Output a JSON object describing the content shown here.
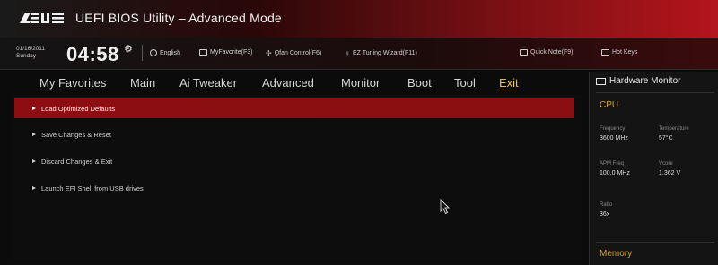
{
  "window": {
    "brand": "ASUS",
    "title": "UEFI BIOS Utility – Advanced Mode",
    "colors": {
      "accent_red": "#8c0e12",
      "active_tab": "#e8c33a",
      "section_gold": "#d8a21e"
    }
  },
  "infobar": {
    "date_line1": "01/16/2011",
    "date_line2": "Sunday",
    "time": "04:58",
    "items": [
      {
        "icon": "globe-icon",
        "label": "English"
      },
      {
        "icon": "favorites-icon",
        "label": "MyFavorite(F3)"
      },
      {
        "icon": "fan-icon",
        "label": "Qfan Control(F6)"
      },
      {
        "icon": "bulb-icon",
        "label": "EZ Tuning Wizard(F11)"
      },
      {
        "icon": "note-icon",
        "label": "Quick Note(F9)"
      },
      {
        "icon": "keyboard-icon",
        "label": "Hot Keys"
      }
    ]
  },
  "tabs": [
    {
      "label": "My Favorites"
    },
    {
      "label": "Main"
    },
    {
      "label": "Ai Tweaker"
    },
    {
      "label": "Advanced"
    },
    {
      "label": "Monitor"
    },
    {
      "label": "Boot"
    },
    {
      "label": "Tool"
    },
    {
      "label": "Exit",
      "active": true
    }
  ],
  "menu": [
    {
      "label": "Load Optimized Defaults",
      "selected": true
    },
    {
      "label": "Save Changes & Reset"
    },
    {
      "label": "Discard Changes & Exit"
    },
    {
      "label": "Launch EFI Shell from USB drives"
    }
  ],
  "hardware_monitor": {
    "title": "Hardware Monitor",
    "cpu": {
      "section": "CPU",
      "frequency_label": "Frequency",
      "frequency_value": "3600 MHz",
      "temperature_label": "Temperature",
      "temperature_value": "57°C",
      "apm_freq_label": "APM Freq",
      "apm_freq_value": "100.0 MHz",
      "vcore_label": "Vcore",
      "vcore_value": "1.362 V",
      "ratio_label": "Ratio",
      "ratio_value": "36x"
    },
    "memory_section": "Memory"
  }
}
